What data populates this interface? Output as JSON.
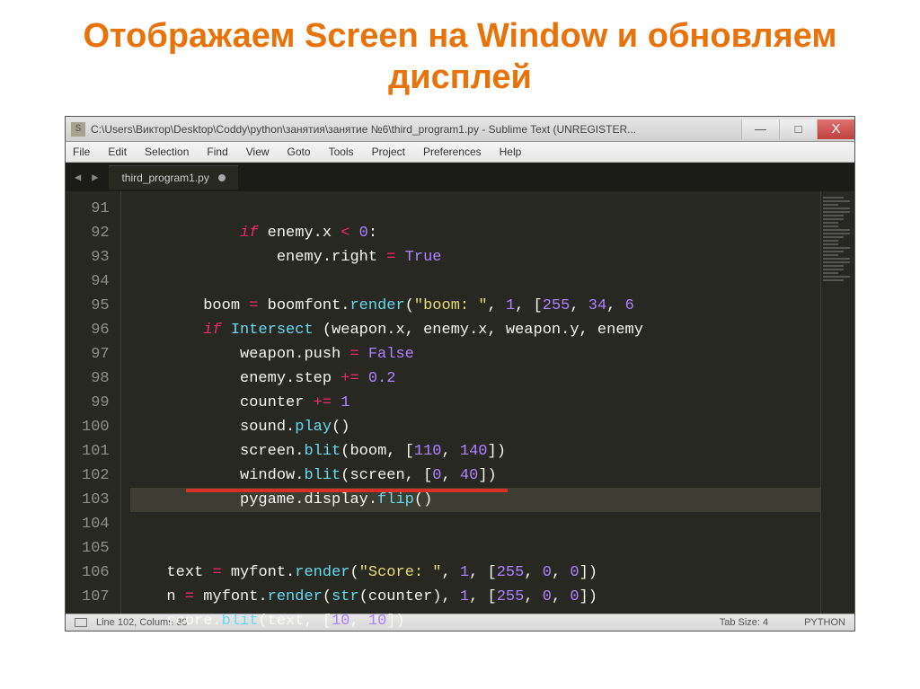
{
  "slide": {
    "title": "Отображаем Screen на Window и обновляем дисплей"
  },
  "window": {
    "title": "C:\\Users\\Виктор\\Desktop\\Coddy\\python\\занятия\\занятие №6\\third_program1.py - Sublime Text (UNREGISTER...",
    "minimize": "—",
    "maximize": "□",
    "close": "X"
  },
  "menu": {
    "file": "File",
    "edit": "Edit",
    "selection": "Selection",
    "find": "Find",
    "view": "View",
    "goto": "Goto",
    "tools": "Tools",
    "project": "Project",
    "preferences": "Preferences",
    "help": "Help"
  },
  "tabs": {
    "nav_prev": "◀",
    "nav_next": "▶",
    "active": "third_program1.py"
  },
  "gutter": [
    "91",
    "92",
    "93",
    "94",
    "95",
    "96",
    "97",
    "98",
    "99",
    "100",
    "101",
    "102",
    "103",
    "104",
    "105",
    "106",
    "107"
  ],
  "code": {
    "l91": {
      "pre": "            ",
      "kw": "if",
      "a": " enemy.x ",
      "op": "<",
      "b": " ",
      "num": "0",
      "c": ":"
    },
    "l92": {
      "pre": "                ",
      "a": "enemy.right ",
      "op": "=",
      "b": " ",
      "const": "True"
    },
    "l93": "",
    "l94": {
      "pre": "        ",
      "a": "boom ",
      "op": "=",
      "b": " boomfont.",
      "fn": "render",
      "c": "(",
      "str": "\"boom: \"",
      "d": ", ",
      "n1": "1",
      "e": ", [",
      "n2": "255",
      "f": ", ",
      "n3": "34",
      "g": ", ",
      "n4": "6"
    },
    "l95": {
      "pre": "        ",
      "kw": "if",
      "a": " ",
      "fn": "Intersect",
      "b": " (weapon.x, enemy.x, weapon.y, enemy"
    },
    "l96": {
      "pre": "            ",
      "a": "weapon.push ",
      "op": "=",
      "b": " ",
      "const": "False"
    },
    "l97": {
      "pre": "            ",
      "a": "enemy.step ",
      "op": "+=",
      "b": " ",
      "num": "0.2"
    },
    "l98": {
      "pre": "            ",
      "a": "counter ",
      "op": "+=",
      "b": " ",
      "num": "1"
    },
    "l99": {
      "pre": "            ",
      "a": "sound.",
      "fn": "play",
      "b": "()"
    },
    "l100": {
      "pre": "            ",
      "a": "screen.",
      "fn": "blit",
      "b": "(boom, [",
      "n1": "110",
      "c": ", ",
      "n2": "140",
      "d": "])"
    },
    "l101": {
      "pre": "            ",
      "a": "window.",
      "fn": "blit",
      "b": "(screen, [",
      "n1": "0",
      "c": ", ",
      "n2": "40",
      "d": "])"
    },
    "l102": {
      "pre": "            ",
      "a": "pygame.display.",
      "fn": "flip",
      "b": "()"
    },
    "l103": "",
    "l104": "",
    "l105": {
      "pre": "    ",
      "a": "text ",
      "op": "=",
      "b": " myfont.",
      "fn": "render",
      "c": "(",
      "str": "\"Score: \"",
      "d": ", ",
      "n1": "1",
      "e": ", [",
      "n2": "255",
      "f": ", ",
      "n3": "0",
      "g": ", ",
      "n4": "0",
      "h": "])"
    },
    "l106": {
      "pre": "    ",
      "a": "n ",
      "op": "=",
      "b": " myfont.",
      "fn": "render",
      "c": "(",
      "fn2": "str",
      "d": "(counter), ",
      "n1": "1",
      "e": ", [",
      "n2": "255",
      "f": ", ",
      "n3": "0",
      "g": ", ",
      "n4": "0",
      "h": "])"
    },
    "l107": {
      "pre": "    ",
      "a": "score.",
      "fn": "blit",
      "b": "(text, [",
      "n1": "10",
      "c": ", ",
      "n2": "10",
      "d": "])"
    }
  },
  "status": {
    "position": "Line 102, Column 30",
    "tabsize": "Tab Size: 4",
    "syntax": "PYTHON"
  }
}
